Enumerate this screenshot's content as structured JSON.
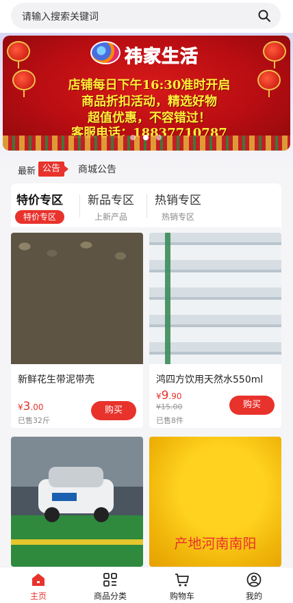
{
  "search": {
    "placeholder": "请输入搜索关键词"
  },
  "banner": {
    "logo_text": "祎家生活",
    "lines": [
      "店铺每日下午16:30准时开启",
      "商品折扣活动，精选好物",
      "超值优惠，不容错过！",
      "客服电话：18837710787"
    ]
  },
  "notice": {
    "label": "最新",
    "tag": "公告",
    "text": "商城公告"
  },
  "tabs": [
    {
      "title": "特价专区",
      "sub": "特价专区"
    },
    {
      "title": "新品专区",
      "sub": "上新产品"
    },
    {
      "title": "热销专区",
      "sub": "热销专区"
    }
  ],
  "products": [
    {
      "name": "新鲜花生带泥带壳",
      "price_symbol": "¥",
      "price_int": "3",
      "price_dec": ".00",
      "original": "",
      "sold": "已售32斤",
      "buy": "购买"
    },
    {
      "name": "鸿四方饮用天然水550ml",
      "price_symbol": "¥",
      "price_int": "9",
      "price_dec": ".90",
      "original": "¥15.00",
      "sold": "已售8件",
      "buy": "购买"
    },
    {
      "name": "",
      "image_text": ""
    },
    {
      "name": "",
      "image_text": "产地河南南阳"
    }
  ],
  "nav": [
    {
      "label": "主页",
      "icon": "home-icon"
    },
    {
      "label": "商品分类",
      "icon": "category-icon"
    },
    {
      "label": "购物车",
      "icon": "cart-icon"
    },
    {
      "label": "我的",
      "icon": "profile-icon"
    }
  ],
  "colors": {
    "accent": "#e8322c"
  }
}
